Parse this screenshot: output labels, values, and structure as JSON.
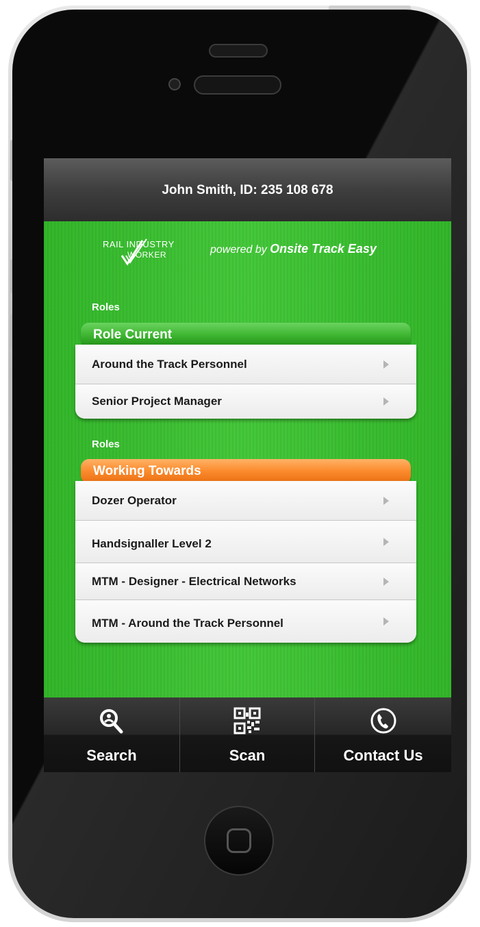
{
  "header": {
    "title": "John Smith,  ID: 235 108 678"
  },
  "branding": {
    "logo_line1": "RAIL INDUSTRY",
    "logo_line2": "WORKER",
    "powered_prefix": "powered by ",
    "powered_brand": "Onsite Track Easy"
  },
  "sections": [
    {
      "label": "Roles",
      "group_title": "Role Current",
      "accent": "#3fb632",
      "items": [
        {
          "label": "Around the Track Personnel"
        },
        {
          "label": "Senior Project Manager"
        }
      ]
    },
    {
      "label": "Roles",
      "group_title": "Working Towards",
      "accent": "#fb8a2c",
      "items": [
        {
          "label": "Dozer Operator"
        },
        {
          "label": "Handsignaller Level 2"
        },
        {
          "label": "MTM - Designer - Electrical Networks"
        },
        {
          "label": "MTM - Around the Track Personnel"
        }
      ]
    }
  ],
  "tabbar": {
    "tabs": [
      {
        "label": "Search",
        "icon": "search-icon"
      },
      {
        "label": "Scan",
        "icon": "qr-code-icon"
      },
      {
        "label": "Contact Us",
        "icon": "phone-icon"
      }
    ]
  },
  "colors": {
    "background_green": "#3dbf33",
    "header_dark": "#3e3e3e",
    "role_current": "#3fb632",
    "working_towards": "#fb8a2c"
  }
}
